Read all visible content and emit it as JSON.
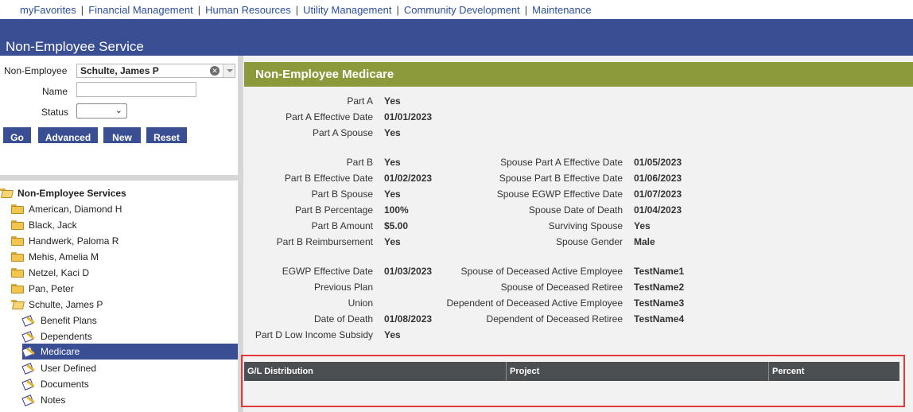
{
  "topnav": {
    "items": [
      "myFavorites",
      "Financial Management",
      "Human Resources",
      "Utility Management",
      "Community Development",
      "Maintenance"
    ],
    "separator": "|"
  },
  "banner": {
    "title": "Non-Employee Service"
  },
  "search": {
    "non_employee_label": "Non-Employee",
    "non_employee_value": "Schulte, James P",
    "name_label": "Name",
    "name_value": "",
    "status_label": "Status",
    "status_value": "",
    "buttons": {
      "go": "Go",
      "advanced": "Advanced",
      "new": "New",
      "reset": "Reset"
    }
  },
  "tree": {
    "root": "Non-Employee Services",
    "people": [
      "American, Diamond H",
      "Black, Jack",
      "Handwerk, Paloma R",
      "Mehis, Amelia M",
      "Netzel, Kaci D",
      "Pan, Peter"
    ],
    "expanded": "Schulte, James P",
    "children": [
      "Benefit Plans",
      "Dependents",
      "Medicare",
      "User Defined",
      "Documents",
      "Notes"
    ],
    "selected": "Medicare"
  },
  "section": {
    "title": "Non-Employee Medicare",
    "fields_left": [
      {
        "label": "Part A",
        "value": "Yes"
      },
      {
        "label": "Part A Effective Date",
        "value": "01/01/2023"
      },
      {
        "label": "Part A Spouse",
        "value": "Yes"
      },
      {
        "label": "Part B",
        "value": "Yes"
      },
      {
        "label": "Part B Effective Date",
        "value": "01/02/2023"
      },
      {
        "label": "Part B Spouse",
        "value": "Yes"
      },
      {
        "label": "Part B Percentage",
        "value": "100%"
      },
      {
        "label": "Part B Amount",
        "value": "$5.00"
      },
      {
        "label": "Part B Reimbursement",
        "value": "Yes"
      },
      {
        "label": "EGWP Effective Date",
        "value": "01/03/2023"
      },
      {
        "label": "Previous Plan",
        "value": ""
      },
      {
        "label": "Union",
        "value": ""
      },
      {
        "label": "Date of Death",
        "value": "01/08/2023"
      },
      {
        "label": "Part D Low Income Subsidy",
        "value": "Yes"
      }
    ],
    "fields_right": [
      {
        "label": "Spouse Part A Effective Date",
        "value": "01/05/2023"
      },
      {
        "label": "Spouse Part B Effective Date",
        "value": "01/06/2023"
      },
      {
        "label": "Spouse EGWP Effective Date",
        "value": "01/07/2023"
      },
      {
        "label": "Spouse Date of Death",
        "value": "01/04/2023"
      },
      {
        "label": "Surviving Spouse",
        "value": "Yes"
      },
      {
        "label": "Spouse Gender",
        "value": "Male"
      },
      {
        "label": "Spouse of Deceased Active Employee",
        "value": "TestName1"
      },
      {
        "label": "Spouse of Deceased Retiree",
        "value": "TestName2"
      },
      {
        "label": "Dependent of Deceased Active Employee",
        "value": "TestName3"
      },
      {
        "label": "Dependent of Deceased Retiree",
        "value": "TestName4"
      }
    ]
  },
  "gl_table": {
    "columns": [
      "G/L Distribution",
      "Project",
      "Percent"
    ]
  },
  "colors": {
    "banner": "#3a4f93",
    "section_header": "#8d9a3c",
    "table_header": "#4b4f52",
    "highlight": "#e03a3a"
  }
}
